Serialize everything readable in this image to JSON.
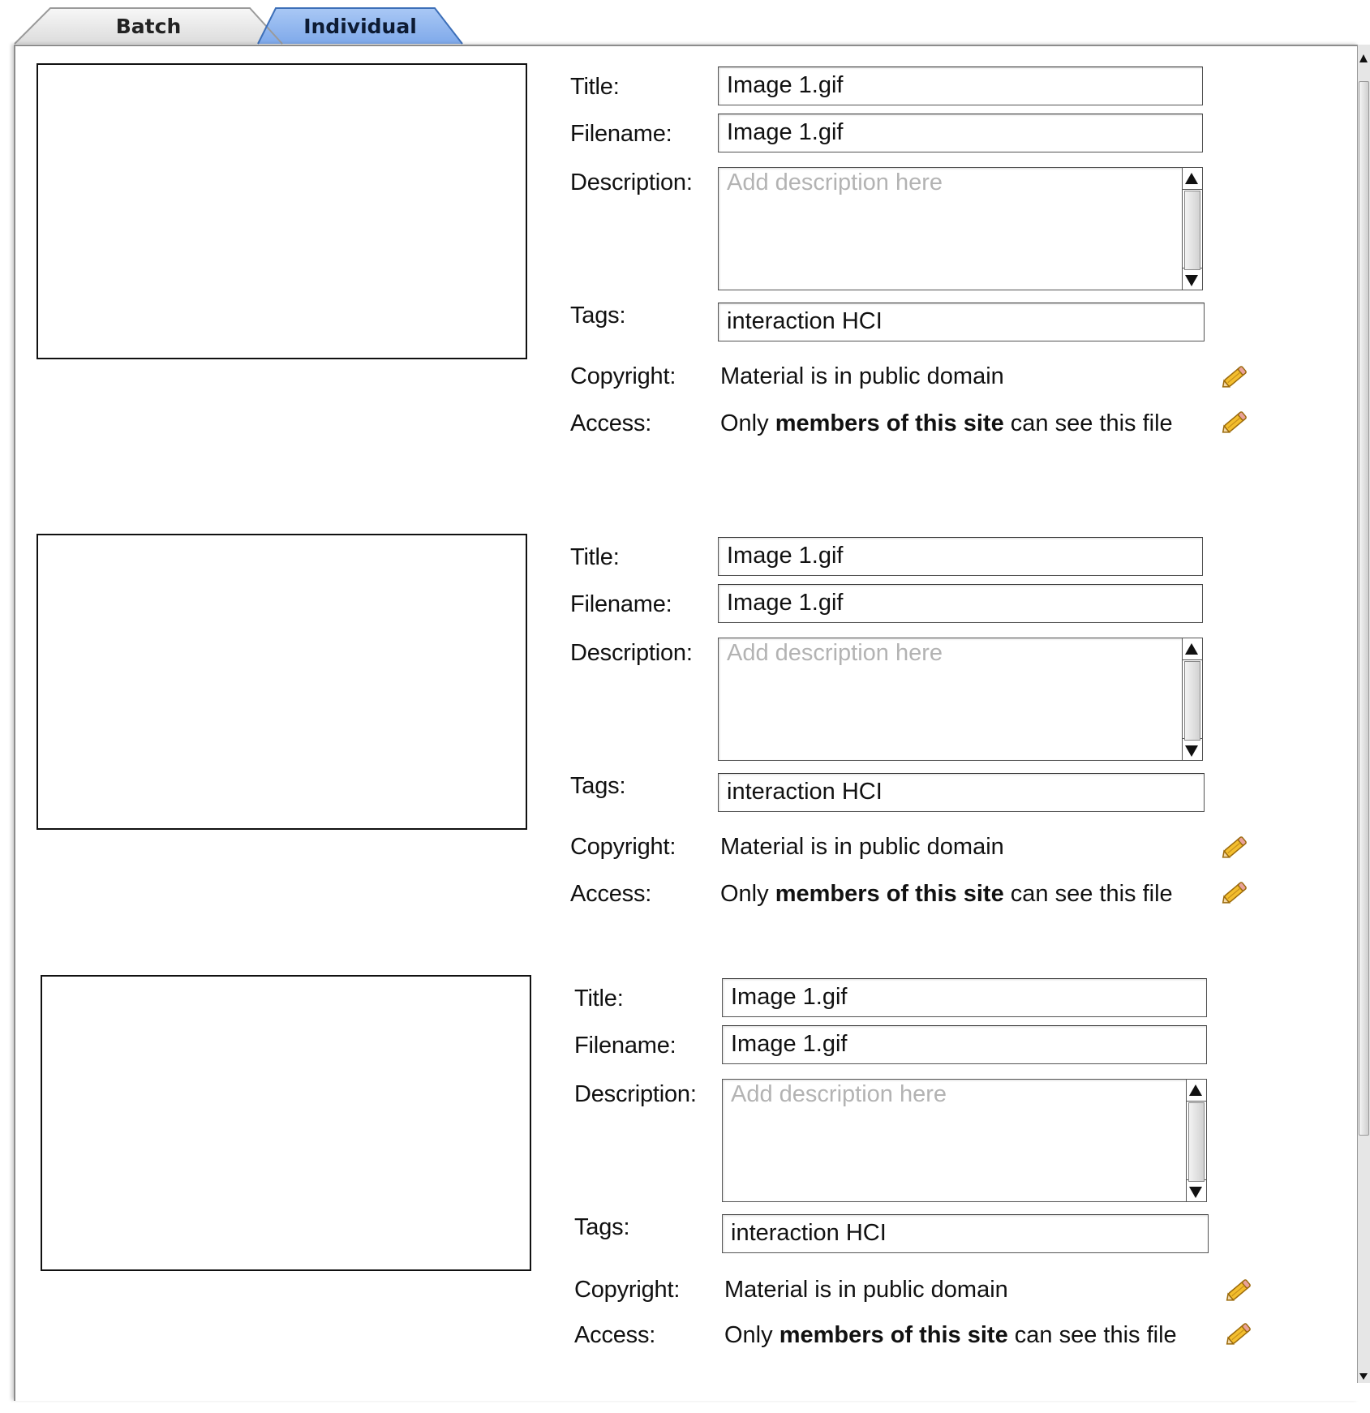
{
  "tabs": [
    {
      "label": "Batch",
      "selected": false
    },
    {
      "label": "Individual",
      "selected": true
    }
  ],
  "labels": {
    "title": "Title:",
    "filename": "Filename:",
    "description": "Description:",
    "tags": "Tags:",
    "copyright": "Copyright:",
    "access": "Access:"
  },
  "items": [
    {
      "title": "Image 1.gif",
      "filename": "Image 1.gif",
      "description_placeholder": "Add description here",
      "tags": "interaction HCI",
      "copyright": "Material is in public domain",
      "access": {
        "prefix": "Only ",
        "emphasis": "members of this site",
        "suffix": " can see this file"
      }
    },
    {
      "title": "Image 1.gif",
      "filename": "Image 1.gif",
      "description_placeholder": "Add description here",
      "tags": "interaction HCI",
      "copyright": "Material is in public domain",
      "access": {
        "prefix": "Only ",
        "emphasis": "members of this site",
        "suffix": " can see this file"
      }
    },
    {
      "title": "Image 1.gif",
      "filename": "Image 1.gif",
      "description_placeholder": "Add description here",
      "tags": "interaction HCI",
      "copyright": "Material is in public domain",
      "access": {
        "prefix": "Only ",
        "emphasis": "members of this site",
        "suffix": " can see this file"
      }
    }
  ],
  "colors": {
    "selected_tab": "#8fb5ee",
    "pencil": "#f0b21e"
  },
  "icons": {
    "edit": "pencil-icon"
  }
}
